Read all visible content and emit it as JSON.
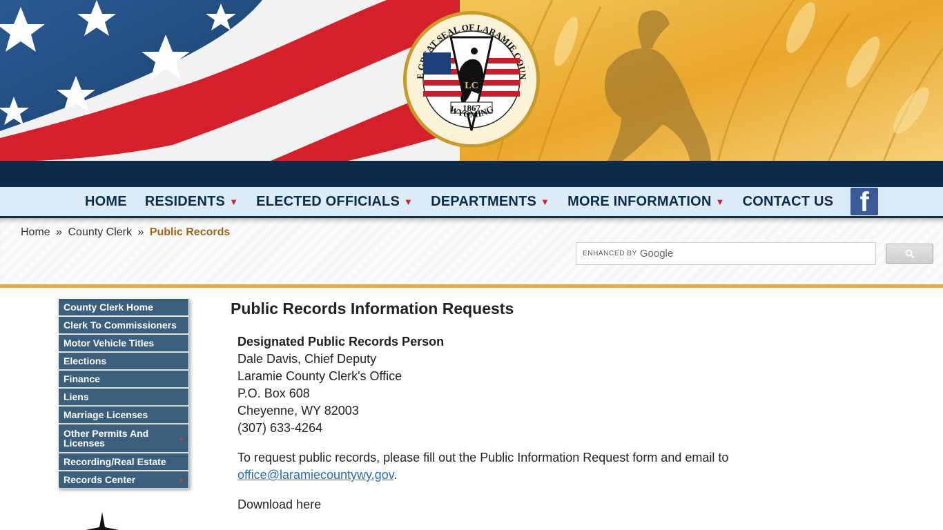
{
  "seal": {
    "arc_top": "THE GREAT SEAL OF LARAMIE COUNTY",
    "initials": "LC",
    "year": "1867",
    "arc_bottom": "WYOMING"
  },
  "nav": {
    "items": [
      {
        "label": "HOME",
        "dropdown": false
      },
      {
        "label": "RESIDENTS",
        "dropdown": true
      },
      {
        "label": "ELECTED OFFICIALS",
        "dropdown": true
      },
      {
        "label": "DEPARTMENTS",
        "dropdown": true
      },
      {
        "label": "MORE INFORMATION",
        "dropdown": true
      },
      {
        "label": "CONTACT US",
        "dropdown": false
      }
    ],
    "caret": "▼",
    "facebook_glyph": "f"
  },
  "breadcrumb": {
    "home": "Home",
    "sep": "»",
    "parent": "County Clerk",
    "current": "Public Records"
  },
  "search": {
    "enhanced_label": "ENHANCED BY",
    "brand": "Google"
  },
  "sidebar": {
    "items": [
      {
        "label": "County Clerk Home",
        "submenu": false
      },
      {
        "label": "Clerk To Commissioners",
        "submenu": false
      },
      {
        "label": "Motor Vehicle Titles",
        "submenu": false
      },
      {
        "label": "Elections",
        "submenu": false
      },
      {
        "label": "Finance",
        "submenu": false
      },
      {
        "label": "Liens",
        "submenu": false
      },
      {
        "label": "Marriage Licenses",
        "submenu": false
      },
      {
        "label": "Other Permits And Licenses",
        "submenu": true
      },
      {
        "label": "Recording/Real Estate",
        "submenu": false
      },
      {
        "label": "Records Center",
        "submenu": true
      }
    ],
    "submenu_arrow": "▸"
  },
  "main": {
    "title": "Public Records Information Requests",
    "contact": {
      "heading": "Designated Public Records Person",
      "name": "Dale Davis, Chief Deputy",
      "office": "Laramie County Clerk's Office",
      "box": "P.O. Box 608",
      "city": "Cheyenne, WY 82003",
      "phone": "(307) 633-4264"
    },
    "request_text": "To request public records, please fill out the Public Information Request form and email to",
    "email": "office@laramiecountywy.gov",
    "period": ".",
    "download": "Download here"
  },
  "colors": {
    "nav_text": "#0d2b4b",
    "dark_band": "#0c2a4a",
    "sidebar_bg": "#3d5f7e",
    "gold_accent": "#e7a84a",
    "breadcrumb_current": "#a0661b",
    "link": "#2b6bb3"
  }
}
